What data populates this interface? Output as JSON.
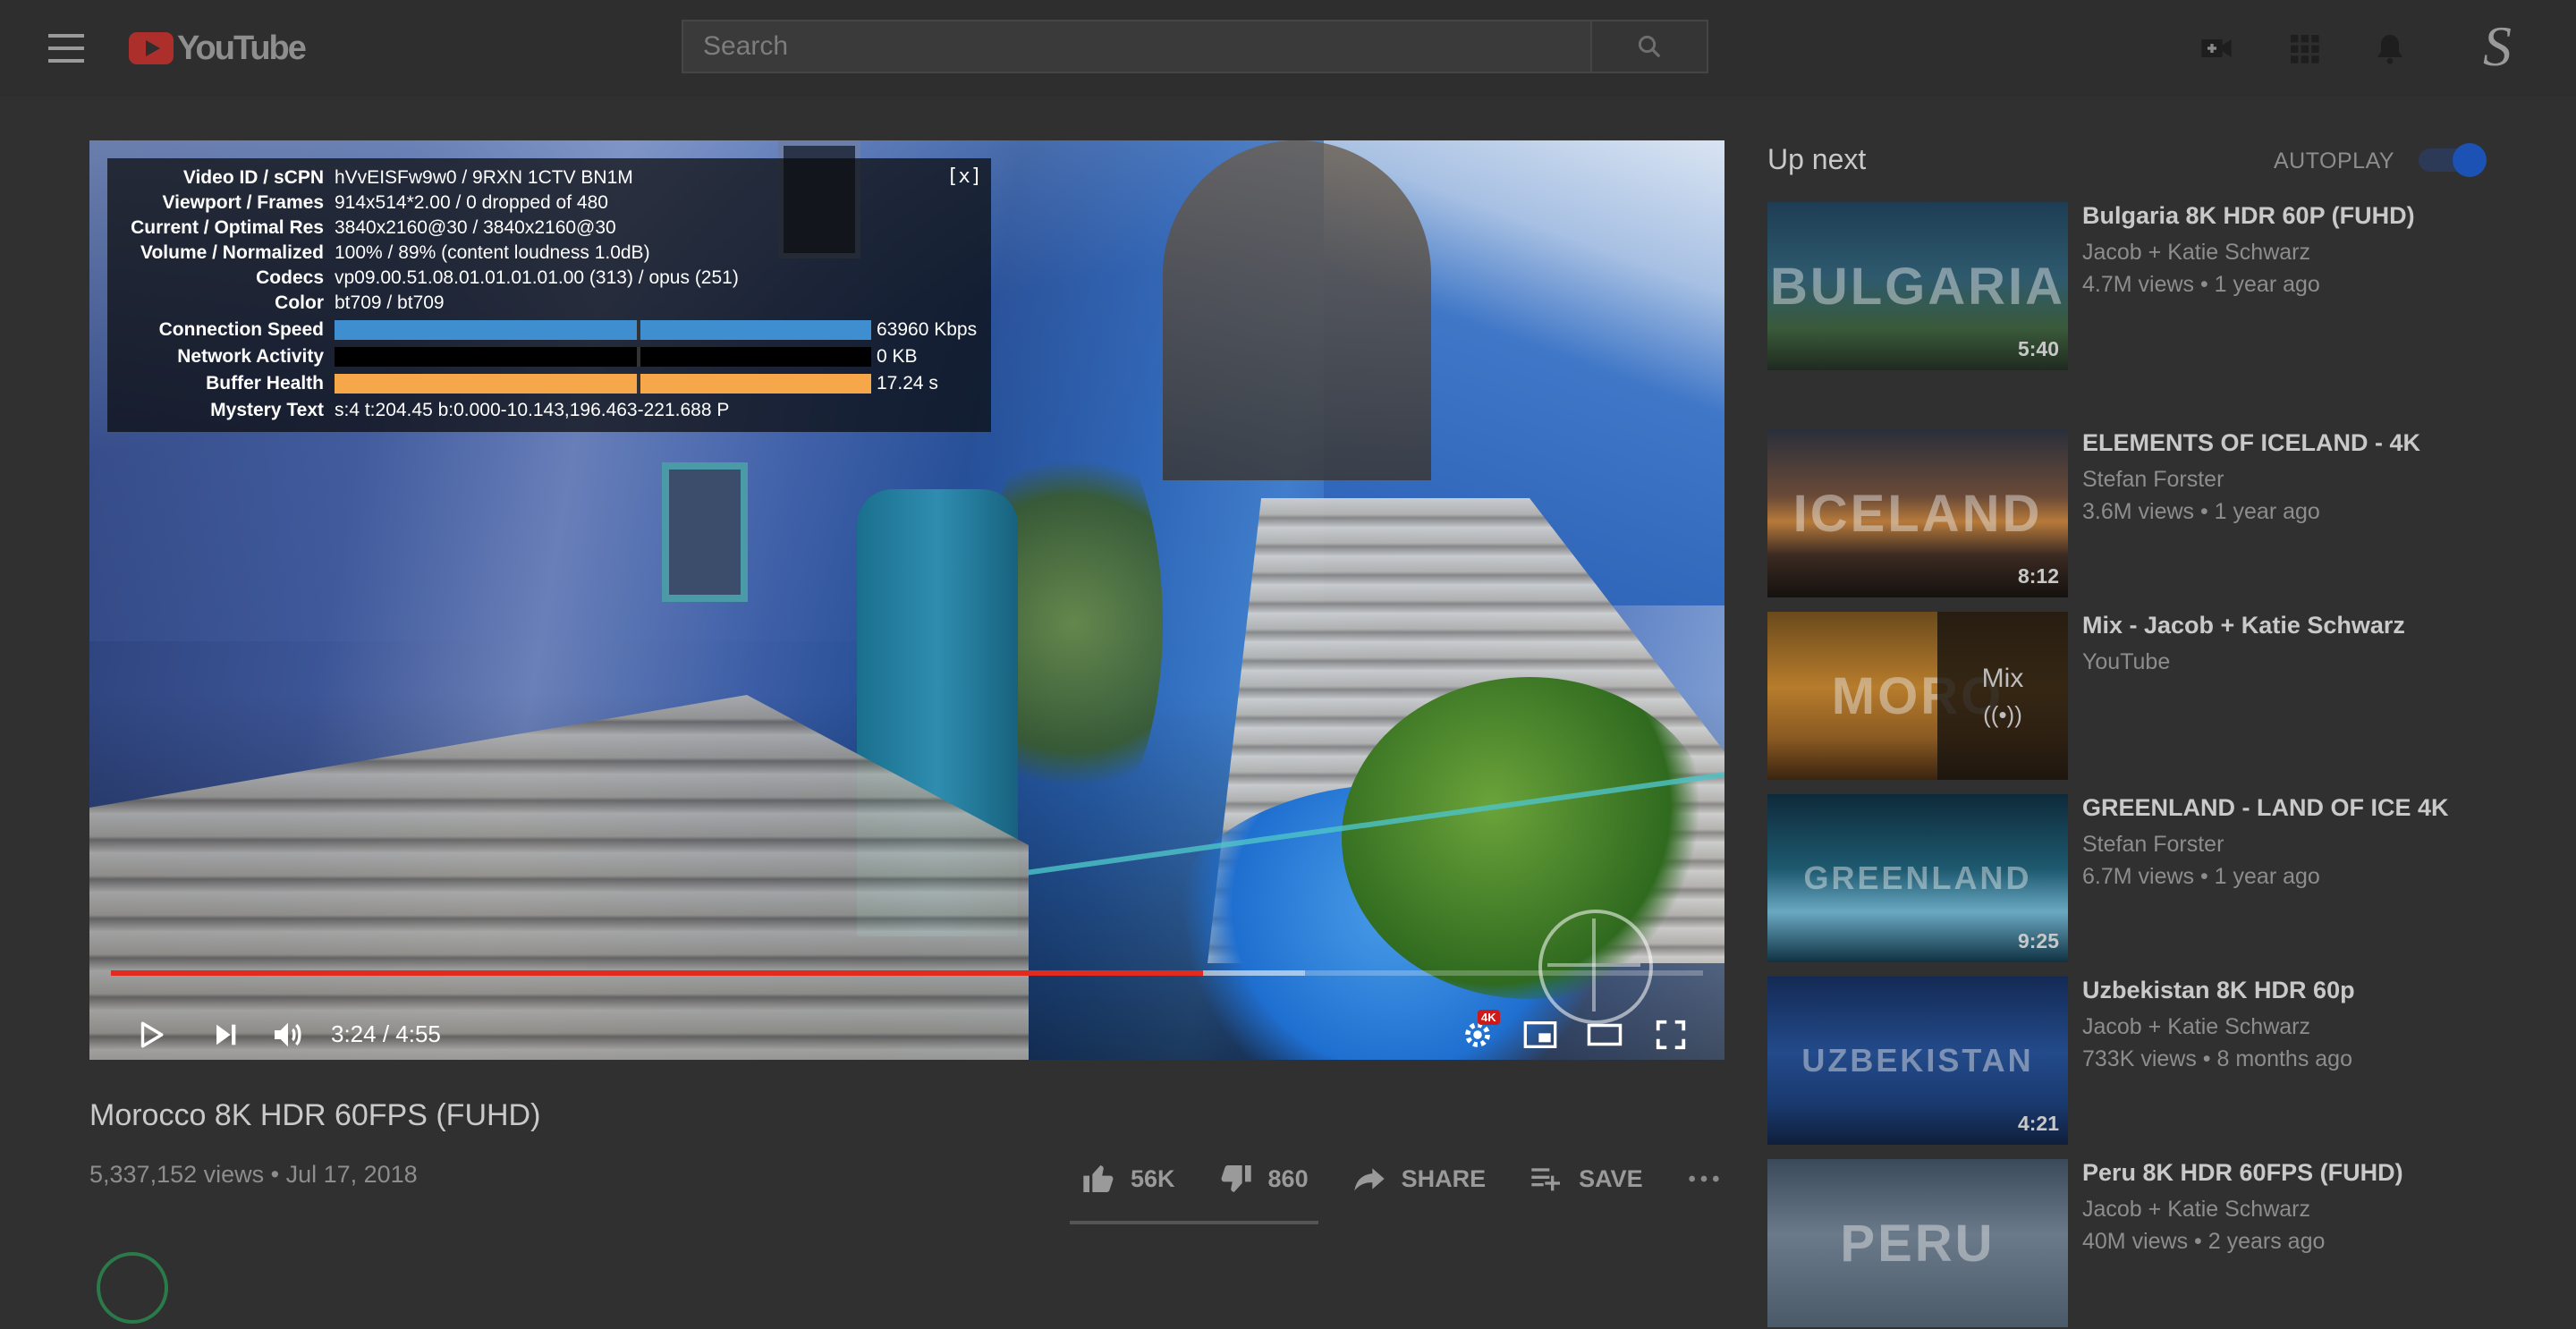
{
  "header": {
    "logo_text": "YouTube",
    "search_placeholder": "Search",
    "avatar_letter": "S"
  },
  "player": {
    "stats": {
      "close_label": "[x]",
      "rows": [
        {
          "label": "Video ID / sCPN",
          "value": "hVvEISFw9w0 / 9RXN 1CTV BN1M"
        },
        {
          "label": "Viewport / Frames",
          "value": "914x514*2.00 / 0 dropped of 480"
        },
        {
          "label": "Current / Optimal Res",
          "value": "3840x2160@30 / 3840x2160@30"
        },
        {
          "label": "Volume / Normalized",
          "value": "100% / 89% (content loudness 1.0dB)"
        },
        {
          "label": "Codecs",
          "value": "vp09.00.51.08.01.01.01.01.00 (313) / opus (251)"
        },
        {
          "label": "Color",
          "value": "bt709 / bt709"
        },
        {
          "label": "Connection Speed",
          "value": "63960 Kbps",
          "bar_fill": 1.0,
          "bar_color": "#3e8ed0"
        },
        {
          "label": "Network Activity",
          "value": "0 KB",
          "bar_fill": 0.0,
          "bar_color": "#3e8ed0"
        },
        {
          "label": "Buffer Health",
          "value": "17.24 s",
          "bar_fill": 1.0,
          "bar_color": "#f5a74a"
        },
        {
          "label": "Mystery Text",
          "value": "s:4 t:204.45 b:0.000-10.143,196.463-221.688 P"
        }
      ]
    },
    "progress_played_fraction": 0.686,
    "progress_buffered_fraction": 0.75,
    "time_display": "3:24 / 4:55",
    "quality_badge": "4K"
  },
  "video": {
    "title": "Morocco 8K HDR 60FPS (FUHD)",
    "meta": "5,337,152 views • Jul 17, 2018",
    "likes": "56K",
    "dislikes": "860",
    "share_label": "SHARE",
    "save_label": "SAVE"
  },
  "upnext": {
    "title": "Up next",
    "autoplay_label": "AUTOPLAY",
    "autoplay_on": true,
    "items": [
      {
        "title": "Bulgaria 8K HDR 60P (FUHD)",
        "channel": "Jacob + Katie Schwarz",
        "views": "4.7M views • 1 year ago",
        "duration": "5:40",
        "thumb_text": "BULGARIA",
        "thumb_bg": "linear-gradient(180deg,#1e3d55 0%,#2e5a6e 45%,#3a5a3a 75%,#1f2a20 100%)"
      },
      {
        "title": "ELEMENTS OF ICELAND - 4K",
        "channel": "Stefan Forster",
        "views": "3.6M views • 1 year ago",
        "duration": "8:12",
        "thumb_text": "ICELAND",
        "thumb_bg": "linear-gradient(180deg,#2a2f3a 0%,#6a4a38 40%,#b77a3a 55%,#3a2a22 75%,#15110e 100%)"
      },
      {
        "title": "Mix - Jacob + Katie Schwarz",
        "channel": "YouTube",
        "views": "",
        "duration": "",
        "thumb_text": "MORO",
        "mix_label": "Mix",
        "mix_radio": "((•))",
        "thumb_bg": "linear-gradient(180deg,#6a4a1c 0%,#b77c2c 45%,#8a5a22 75%,#3a2410 100%)"
      },
      {
        "title": "GREENLAND - LAND OF ICE 4K",
        "channel": "Stefan Forster",
        "views": "6.7M views • 1 year ago",
        "duration": "9:25",
        "thumb_text": "GREENLAND",
        "thumb_bg": "linear-gradient(180deg,#0e2a3a 0%,#1e5a70 45%,#6aa8c2 70%,#0f3242 100%)"
      },
      {
        "title": "Uzbekistan 8K HDR 60p",
        "channel": "Jacob + Katie Schwarz",
        "views": "733K views • 8 months ago",
        "duration": "4:21",
        "thumb_text": "UZBEKISTAN",
        "thumb_bg": "linear-gradient(180deg,#142a55 0%,#234a8a 45%,#1a3a70 75%,#0f1f3a 100%)"
      },
      {
        "title": "Peru 8K HDR 60FPS (FUHD)",
        "channel": "Jacob + Katie Schwarz",
        "views": "40M views • 2 years ago",
        "duration": "",
        "thumb_text": "PERU",
        "thumb_bg": "linear-gradient(180deg,#3a4a5a 0%,#6a7a8a 45%,#4a5a68 100%)"
      }
    ]
  },
  "colors": {
    "background": "#303030",
    "progress_red": "#e32a1f",
    "accent_blue": "#1c52b4"
  }
}
